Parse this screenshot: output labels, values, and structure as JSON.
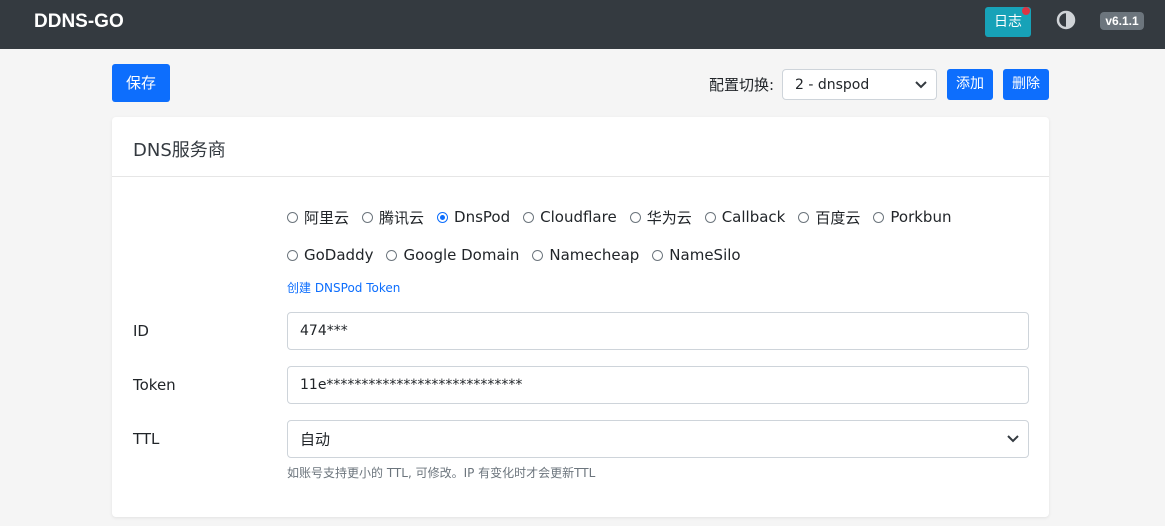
{
  "navbar": {
    "brand": "DDNS-GO",
    "log_button": "日志",
    "version": "v6.1.1"
  },
  "toolbar": {
    "save_label": "保存",
    "config_switch_label": "配置切换:",
    "config_selected": "2 - dnspod",
    "add_label": "添加",
    "delete_label": "删除"
  },
  "card": {
    "title": "DNS服务商",
    "providers_row1": [
      {
        "label": "阿里云",
        "checked": false
      },
      {
        "label": "腾讯云",
        "checked": false
      },
      {
        "label": "DnsPod",
        "checked": true
      },
      {
        "label": "Cloudflare",
        "checked": false
      },
      {
        "label": "华为云",
        "checked": false
      },
      {
        "label": "Callback",
        "checked": false
      },
      {
        "label": "百度云",
        "checked": false
      },
      {
        "label": "Porkbun",
        "checked": false
      }
    ],
    "providers_row2": [
      {
        "label": "GoDaddy",
        "checked": false
      },
      {
        "label": "Google Domain",
        "checked": false
      },
      {
        "label": "Namecheap",
        "checked": false
      },
      {
        "label": "NameSilo",
        "checked": false
      }
    ],
    "token_link": "创建 DNSPod Token",
    "id_label": "ID",
    "id_value": "474***",
    "token_label": "Token",
    "token_value": "11e****************************",
    "ttl_label": "TTL",
    "ttl_value": "自动",
    "ttl_help": "如账号支持更小的 TTL, 可修改。IP 有变化时才会更新TTL"
  },
  "colors": {
    "navbar_bg": "#343a40",
    "primary": "#0d6efd",
    "info": "#17a2b8",
    "badge": "#6c757d",
    "alert_dot": "#dc3545"
  },
  "icons": {
    "theme": "contrast-icon",
    "select": "chevron-down-icon"
  }
}
